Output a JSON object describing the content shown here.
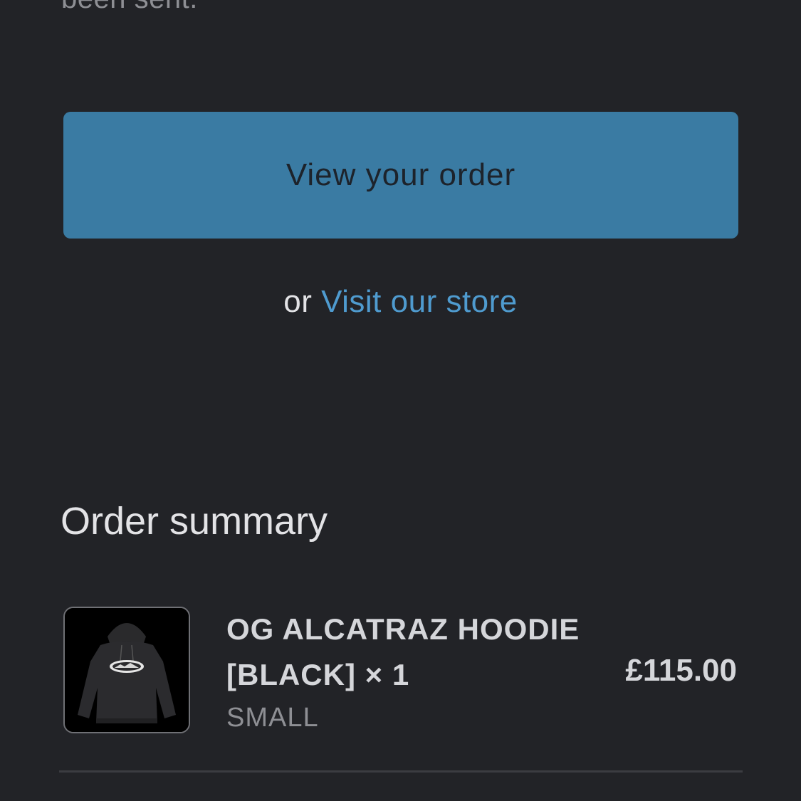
{
  "intro": {
    "tail_text": "been sent."
  },
  "actions": {
    "view_order_label": "View your order",
    "or_text": "or",
    "visit_store_label": "Visit our store"
  },
  "summary": {
    "title": "Order summary",
    "items": [
      {
        "name": "OG ALCATRAZ HOODIE [BLACK] × 1",
        "variant": "SMALL",
        "price": "£115.00",
        "image": "black-hoodie-thumbnail"
      }
    ]
  },
  "colors": {
    "background": "#222327",
    "button": "#3a7ba3",
    "link": "#4f9bcf"
  }
}
